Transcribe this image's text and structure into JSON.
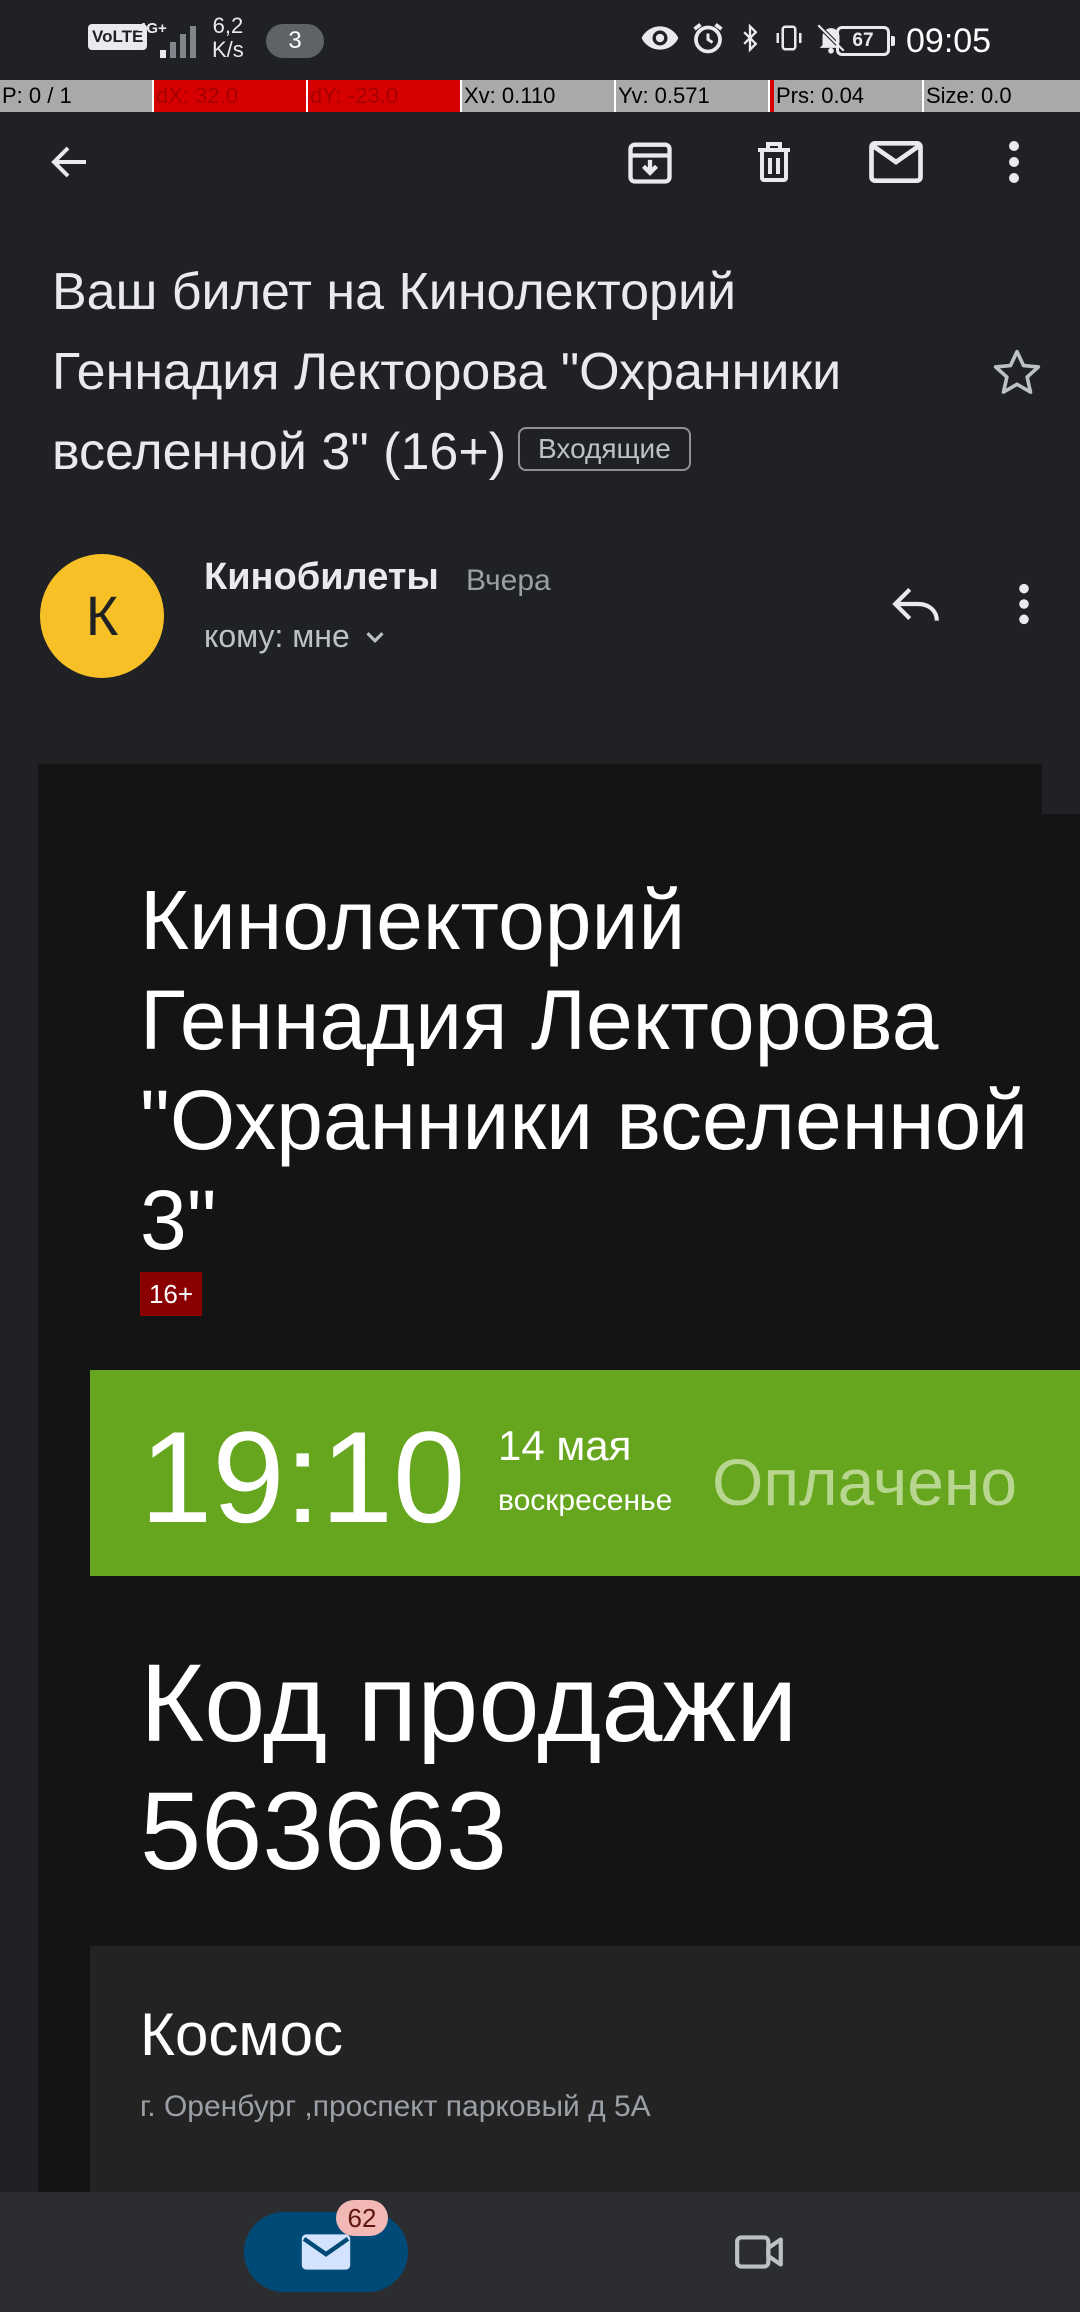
{
  "status_bar": {
    "volte": "VoLTE",
    "network": "4G+",
    "speed_value": "6,2",
    "speed_unit": "K/s",
    "notification_count": "3",
    "battery": "67",
    "time": "09:05"
  },
  "debug_bar": {
    "pointer": "P: 0 / 1",
    "dx": "dX: 32.0",
    "dy": "dY: -23.0",
    "xv": "Xv: 0.110",
    "yv": "Yv: 0.571",
    "prs": "Prs: 0.04",
    "size": "Size: 0.0"
  },
  "toolbar": {
    "back_icon": "arrow-back-icon",
    "archive_icon": "archive-icon",
    "delete_icon": "delete-icon",
    "mark_unread_icon": "mail-icon",
    "more_icon": "more-vert-icon"
  },
  "email": {
    "subject": "Ваш билет на Кинолекторий Геннадия Лекторова  \"Охранники вселенной 3\" (16+)",
    "label": "Входящие",
    "sender_initial": "К",
    "sender_name": "Кинобилеты",
    "date": "Вчера",
    "recipient": "кому: мне"
  },
  "ticket": {
    "event_title": "Кинолекторий Геннадия Лекторова \"Охранники вселенной 3\"",
    "age_rating": "16+",
    "time": "19:10",
    "date": "14 мая",
    "weekday": "воскресенье",
    "status": "Оплачено",
    "sale_code_label": "Код продажи",
    "sale_code": "563663",
    "venue_name": "Космос",
    "venue_address": "г. Оренбург ,проспект парковый д 5А"
  },
  "bottom_nav": {
    "mail_badge": "62",
    "mail_icon": "mail-icon",
    "meet_icon": "video-camera-icon"
  },
  "colors": {
    "background": "#202124",
    "email_body": "#141414",
    "paid_bar": "#66a61e",
    "age_badge": "#8b0000",
    "avatar": "#f6c026",
    "nav_active": "#004a77"
  }
}
